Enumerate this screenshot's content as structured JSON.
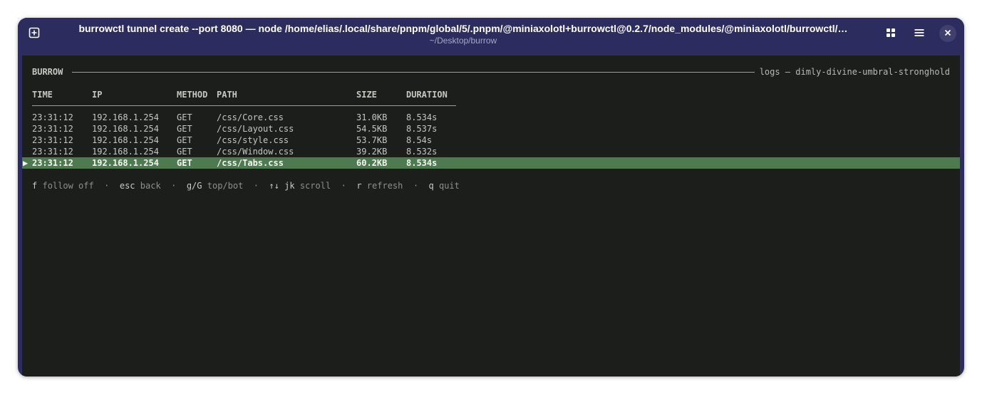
{
  "window": {
    "title": "burrowctl tunnel create --port 8080 — node /home/elias/.local/share/pnpm/global/5/.pnpm/@miniaxolotl+burrowctl@0.2.7/node_modules/@miniaxolotl/burrowctl/…",
    "subtitle": "~/Desktop/burrow",
    "icons": {
      "new_tab": "new-tab-icon",
      "grid": "grid-view-icon",
      "menu": "hamburger-menu-icon",
      "close": "close-icon"
    }
  },
  "terminal": {
    "app_name": "BURROW",
    "view_title": "logs — dimly-divine-umbral-stronghold",
    "columns": {
      "time": "TIME",
      "ip": "IP",
      "method": "METHOD",
      "path": "PATH",
      "size": "SIZE",
      "duration": "DURATION"
    },
    "rows": [
      {
        "time": "23:31:12",
        "ip": "192.168.1.254",
        "method": "GET",
        "path": "/css/Core.css",
        "size": "31.0KB",
        "duration": "8.534s"
      },
      {
        "time": "23:31:12",
        "ip": "192.168.1.254",
        "method": "GET",
        "path": "/css/Layout.css",
        "size": "54.5KB",
        "duration": "8.537s"
      },
      {
        "time": "23:31:12",
        "ip": "192.168.1.254",
        "method": "GET",
        "path": "/css/style.css",
        "size": "53.7KB",
        "duration": "8.54s"
      },
      {
        "time": "23:31:12",
        "ip": "192.168.1.254",
        "method": "GET",
        "path": "/css/Window.css",
        "size": "39.2KB",
        "duration": "8.532s"
      },
      {
        "time": "23:31:12",
        "ip": "192.168.1.254",
        "method": "GET",
        "path": "/css/Tabs.css",
        "size": "60.2KB",
        "duration": "8.534s"
      }
    ],
    "selected_marker": "▶",
    "footer": {
      "follow_key": "f",
      "follow_desc": "follow off",
      "back_key": "esc",
      "back_desc": "back",
      "top_key": "g/G",
      "top_desc": "top/bot",
      "scroll_key": "↑↓ jk",
      "scroll_desc": "scroll",
      "refresh_key": "r",
      "refresh_desc": "refresh",
      "quit_key": "q",
      "quit_desc": "quit",
      "separator": "·"
    }
  },
  "colors": {
    "headerbar": "#2d2c5e",
    "terminal_bg": "#1b1e1b",
    "selected_row": "#4e7a50"
  }
}
